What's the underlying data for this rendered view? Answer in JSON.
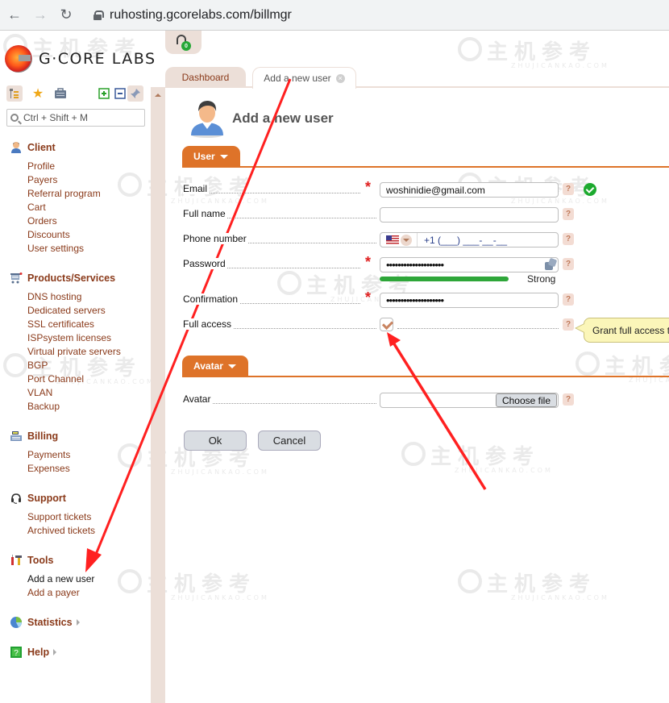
{
  "browser": {
    "url": "ruhosting.gcorelabs.com/billmgr",
    "back_icon": "arrow-left",
    "forward_icon": "arrow-right",
    "reload_icon": "reload"
  },
  "logo": {
    "text": "G·CORE LABS"
  },
  "sidebar": {
    "toolbar_icons": [
      "tree-icon",
      "favorites-star-icon",
      "briefcase-icon",
      "expand-all-icon",
      "collapse-all-icon",
      "pin-icon"
    ],
    "search_placeholder": "Ctrl + Shift + M",
    "groups": [
      {
        "title": "Client",
        "icon": "user-icon",
        "items": [
          "Profile",
          "Payers",
          "Referral program",
          "Cart",
          "Orders",
          "Discounts",
          "User settings"
        ]
      },
      {
        "title": "Products/Services",
        "icon": "cart-icon",
        "items": [
          "DNS hosting",
          "Dedicated servers",
          "SSL certificates",
          "ISPsystem licenses",
          "Virtual private servers",
          "BGP",
          "Port Channel",
          "VLAN",
          "Backup"
        ]
      },
      {
        "title": "Billing",
        "icon": "cash-register-icon",
        "items": [
          "Payments",
          "Expenses"
        ]
      },
      {
        "title": "Support",
        "icon": "headset-icon",
        "items": [
          "Support tickets",
          "Archived tickets"
        ]
      },
      {
        "title": "Tools",
        "icon": "tools-icon",
        "items": [
          "Add a new user",
          "Add a payer"
        ],
        "active_item": "Add a new user"
      },
      {
        "title": "Statistics",
        "icon": "pie-chart-icon",
        "collapsed": true,
        "items": []
      },
      {
        "title": "Help",
        "icon": "help-book-icon",
        "collapsed": true,
        "items": []
      }
    ]
  },
  "header": {
    "support_badge_count": "0"
  },
  "tabs": [
    {
      "label": "Dashboard",
      "active": false
    },
    {
      "label": "Add a new user",
      "active": true,
      "closable": true
    }
  ],
  "page": {
    "title": "Add a new user",
    "sections": {
      "user": "User",
      "avatar": "Avatar"
    },
    "fields": {
      "email": {
        "label": "Email",
        "value": "woshinidie@gmail.com",
        "required": true,
        "valid": true
      },
      "full_name": {
        "label": "Full name",
        "value": ""
      },
      "phone": {
        "label": "Phone number",
        "country": "US",
        "mask": "+1 (___) ___-__-__"
      },
      "password": {
        "label": "Password",
        "required": true,
        "value_masked": "••••••••••••••••••••",
        "strength_label": "Strong",
        "strength": 0.85
      },
      "confirmation": {
        "label": "Confirmation",
        "required": true,
        "value_masked": "••••••••••••••••••••"
      },
      "full_access": {
        "label": "Full access",
        "checked": true,
        "tooltip": "Grant full access t"
      },
      "avatar": {
        "label": "Avatar",
        "button_label": "Choose file"
      }
    },
    "required_mark": "*",
    "help_mark": "?",
    "buttons": {
      "ok": "Ok",
      "cancel": "Cancel"
    }
  },
  "watermark": {
    "cn": "主机参考",
    "en": "ZHUJICANKAO.COM"
  },
  "annotations": {
    "arrow_color": "#ff2020"
  }
}
